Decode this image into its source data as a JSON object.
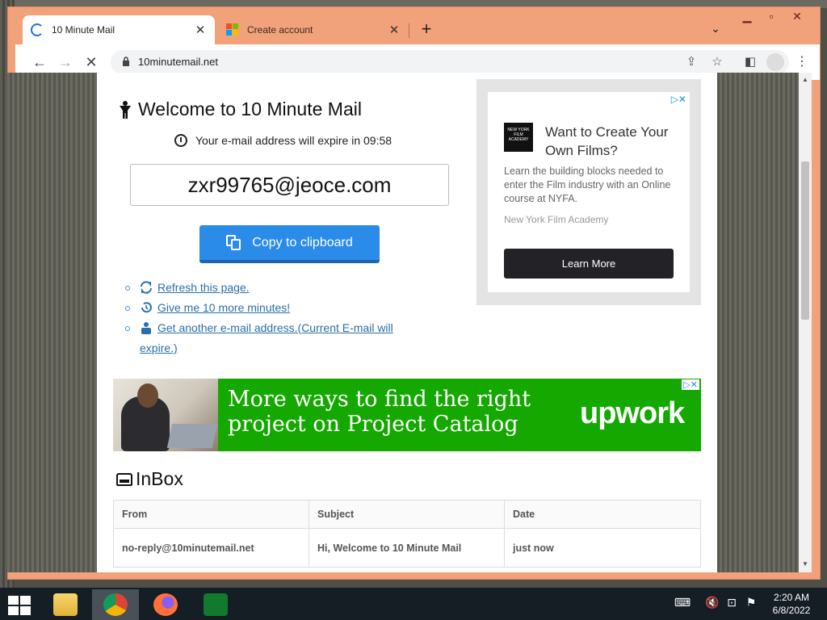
{
  "browser": {
    "tabs": [
      {
        "label": "10 Minute Mail",
        "active": true
      },
      {
        "label": "Create account",
        "active": false
      }
    ],
    "url": "10minutemail.net"
  },
  "page": {
    "welcome_title": "Welcome to 10 Minute Mail",
    "expire_text": "Your e-mail address will expire in 09:58",
    "email_address": "zxr99765@jeoce.com",
    "copy_button_label": "Copy to clipboard",
    "links": [
      {
        "label": "Refresh this page.",
        "icon": "refresh-icon"
      },
      {
        "label": "Give me 10 more minutes!",
        "icon": "history-icon"
      },
      {
        "label": "Get another e-mail address.(Current E-mail will expire.)",
        "icon": "user-icon"
      }
    ]
  },
  "ad_right": {
    "headline": "Want to Create Your Own Films?",
    "body": "Learn the building blocks needed to enter the Film industry with an Online course at NYFA.",
    "source": "New York Film Academy",
    "button_label": "Learn More",
    "logo_text": "NEW YORK FILM ACADEMY"
  },
  "banner_ad": {
    "text": "More ways to find the right project on Project Catalog",
    "brand": "upwork"
  },
  "inbox": {
    "title": "InBox",
    "columns": [
      "From",
      "Subject",
      "Date"
    ],
    "rows": [
      {
        "from": "no-reply@10minutemail.net",
        "subject": "Hi, Welcome to 10 Minute Mail",
        "date": "just now"
      }
    ]
  },
  "taskbar": {
    "time": "2:20 AM",
    "date": "6/8/2022"
  },
  "colors": {
    "accent_blue": "#2a8ce8",
    "chrome_frame": "#f1a27a",
    "upwork_green": "#14a800"
  }
}
